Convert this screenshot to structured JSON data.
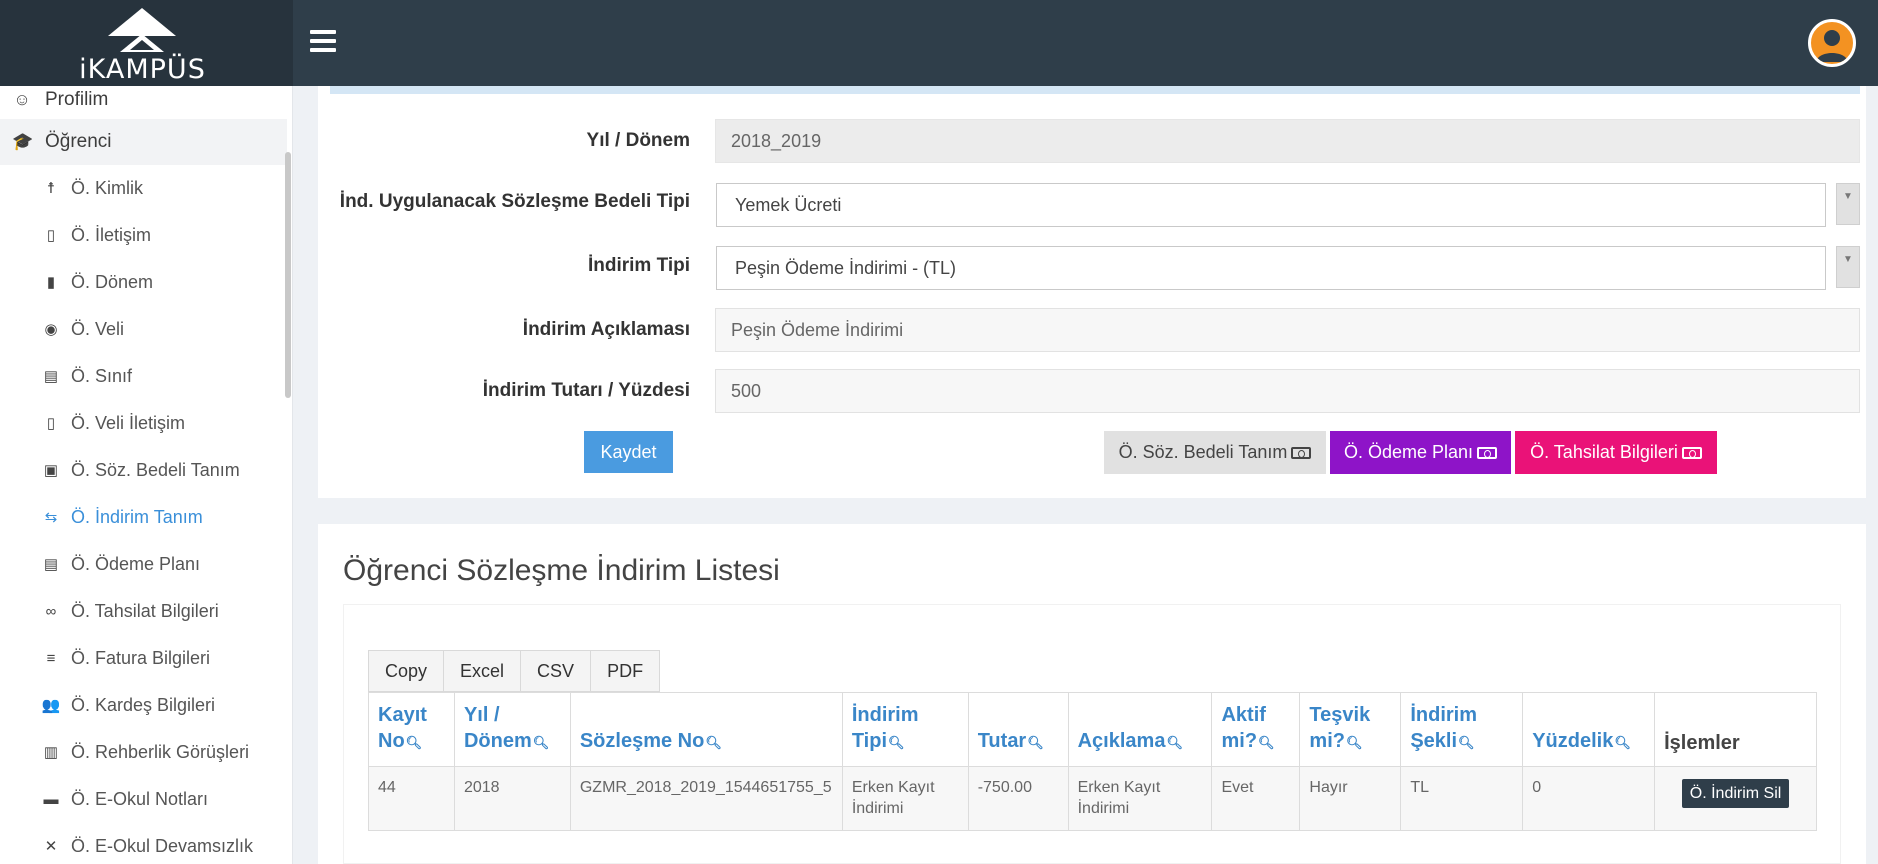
{
  "header": {
    "logo_text": "iKAMPÜS"
  },
  "sidebar": {
    "items": [
      {
        "label": "Profilim"
      },
      {
        "label": "Öğrenci"
      },
      {
        "label": "Ö. Kimlik"
      },
      {
        "label": "Ö. İletişim"
      },
      {
        "label": "Ö. Dönem"
      },
      {
        "label": "Ö. Veli"
      },
      {
        "label": "Ö. Sınıf"
      },
      {
        "label": "Ö. Veli İletişim"
      },
      {
        "label": "Ö. Söz. Bedeli Tanım"
      },
      {
        "label": "Ö. İndirim Tanım"
      },
      {
        "label": "Ö. Ödeme Planı"
      },
      {
        "label": "Ö. Tahsilat Bilgileri"
      },
      {
        "label": "Ö. Fatura Bilgileri"
      },
      {
        "label": "Ö. Kardeş Bilgileri"
      },
      {
        "label": "Ö. Rehberlik Görüşleri"
      },
      {
        "label": "Ö. E-Okul Notları"
      },
      {
        "label": "Ö. E-Okul Devamsızlık"
      }
    ],
    "active_item": "Ö. İndirim Tanım"
  },
  "form": {
    "year_label": "Yıl / Dönem",
    "year_value": "2018_2019",
    "contract_type_label": "İnd. Uygulanacak Sözleşme Bedeli Tipi",
    "contract_type_value": "Yemek Ücreti",
    "discount_type_label": "İndirim Tipi",
    "discount_type_value": "Peşin Ödeme İndirimi - (TL)",
    "description_label": "İndirim Açıklaması",
    "description_placeholder": "Peşin Ödeme İndirimi",
    "amount_label": "İndirim Tutarı / Yüzdesi",
    "amount_value": "500",
    "save_label": "Kaydet",
    "btn_soz_label": "Ö. Söz. Bedeli Tanım",
    "btn_odeme_label": "Ö. Ödeme Planı",
    "btn_tahsilat_label": "Ö. Tahsilat Bilgileri"
  },
  "list": {
    "title": "Öğrenci Sözleşme İndirim Listesi",
    "export_buttons": [
      "Copy",
      "Excel",
      "CSV",
      "PDF"
    ],
    "columns": [
      {
        "l1": "Kayıt",
        "l2": "No"
      },
      {
        "l1": "Yıl /",
        "l2": "Dönem"
      },
      {
        "l1": "",
        "l2": "Sözleşme No"
      },
      {
        "l1": "İndirim",
        "l2": "Tipi"
      },
      {
        "l1": "",
        "l2": "Tutar"
      },
      {
        "l1": "",
        "l2": "Açıklama"
      },
      {
        "l1": "Aktif",
        "l2": "mi?"
      },
      {
        "l1": "Teşvik",
        "l2": "mi?"
      },
      {
        "l1": "İndirim",
        "l2": "Şekli"
      },
      {
        "l1": "",
        "l2": "Yüzdelik"
      },
      {
        "l1": "",
        "l2": "İşlemler"
      }
    ],
    "rows": [
      {
        "kayit_no": "44",
        "yil": "2018",
        "sozlesme_no": "GZMR_2018_2019_1544651755_5",
        "indirim_tipi_1": "Erken Kayıt",
        "indirim_tipi_2": "İndirimi",
        "tutar": "-750.00",
        "aciklama_1": "Erken Kayıt",
        "aciklama_2": "İndirimi",
        "aktif": "Evet",
        "tesvik": "Hayır",
        "sekil": "TL",
        "yuzdelik": "0",
        "delete_label": "Ö. İndirim Sil"
      }
    ]
  }
}
